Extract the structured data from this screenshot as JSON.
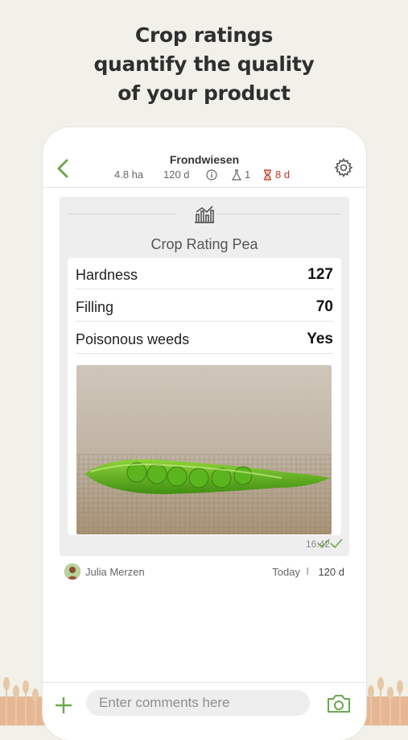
{
  "headline": {
    "line1": "Crop ratings",
    "line2": "quantify the quality",
    "line3": "of your product"
  },
  "header": {
    "field_name": "Frondwiesen",
    "area": "4.8 ha",
    "days": "120 d",
    "samples": "1",
    "countdown": "8 d",
    "accent": "#6aa84f",
    "warning_color": "#c0392b"
  },
  "card": {
    "title": "Crop Rating Pea",
    "rows": [
      {
        "label": "Hardness",
        "value": "127"
      },
      {
        "label": "Filling",
        "value": "70"
      },
      {
        "label": "Poisonous weeds",
        "value": "Yes"
      }
    ],
    "time": "16:42"
  },
  "author": {
    "name": "Julia Merzen",
    "date": "Today",
    "separator": "I",
    "duration": "120 d"
  },
  "composer": {
    "placeholder": "Enter comments here"
  },
  "icons": {
    "back": "chevron-left-icon",
    "info": "info-icon",
    "flask": "flask-icon",
    "hourglass": "hourglass-icon",
    "settings": "gear-icon",
    "chart": "bar-chart-icon",
    "read": "double-check-icon",
    "add": "plus-icon",
    "camera": "camera-icon"
  }
}
